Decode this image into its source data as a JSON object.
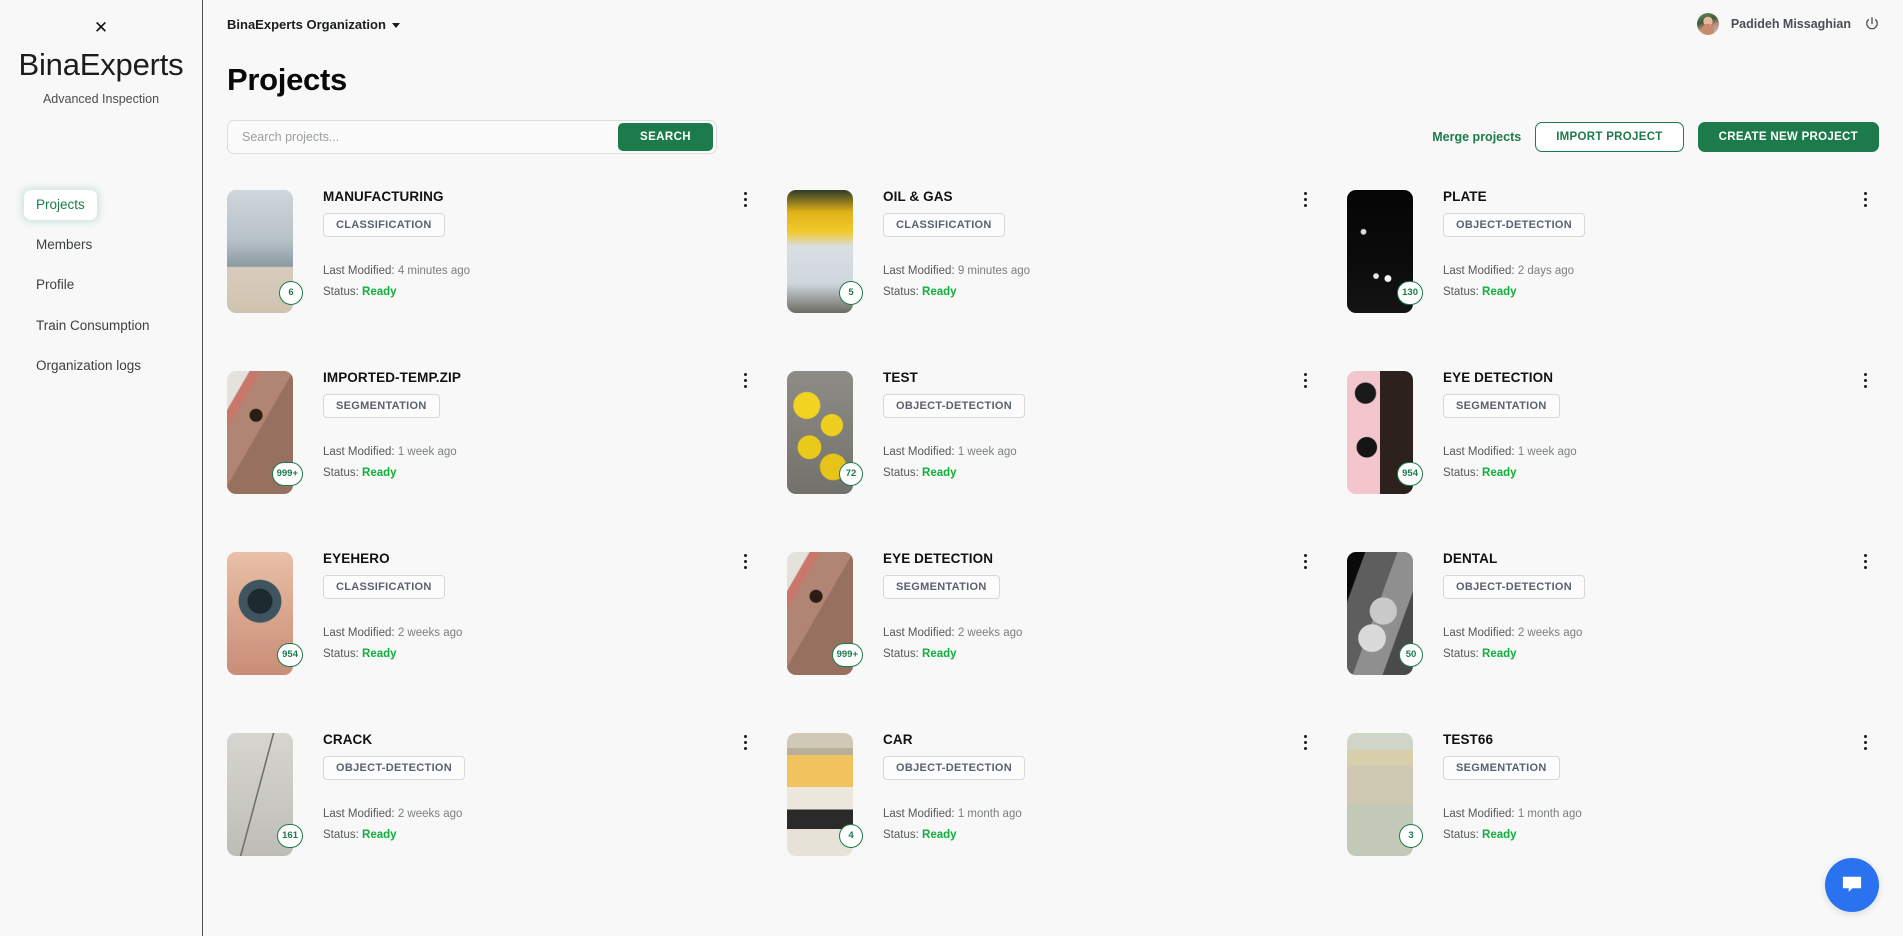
{
  "sidebar": {
    "close_icon": "close-icon",
    "brand": "BinaExperts",
    "tagline": "Advanced Inspection",
    "items": [
      {
        "label": "Projects",
        "active": true
      },
      {
        "label": "Members",
        "active": false
      },
      {
        "label": "Profile",
        "active": false
      },
      {
        "label": "Train Consumption",
        "active": false
      },
      {
        "label": "Organization logs",
        "active": false
      }
    ]
  },
  "topbar": {
    "organization": "BinaExperts Organization",
    "user_name": "Padideh Missaghian",
    "power_icon": "power-icon",
    "avatar_icon": "avatar"
  },
  "page": {
    "title": "Projects"
  },
  "search": {
    "placeholder": "Search projects...",
    "value": "",
    "button_label": "SEARCH"
  },
  "actions": {
    "merge_label": "Merge projects",
    "import_label": "IMPORT PROJECT",
    "create_label": "CREATE NEW PROJECT"
  },
  "labels": {
    "last_modified": "Last Modified:",
    "status": "Status:"
  },
  "colors": {
    "brand_green": "#1d7b4b",
    "status_green": "#0fb03c",
    "chat_blue": "#2a72f0",
    "page_bg": "#f7f8f7"
  },
  "chat": {
    "icon": "chat-bubble-icon"
  },
  "projects": [
    {
      "name": "MANUFACTURING",
      "type": "CLASSIFICATION",
      "modified": "4 minutes ago",
      "status": "Ready",
      "count": "6",
      "thumb": "manufacturing-robot-conveyor"
    },
    {
      "name": "OIL & GAS",
      "type": "CLASSIFICATION",
      "modified": "9 minutes ago",
      "status": "Ready",
      "count": "5",
      "thumb": "engineer-excavator"
    },
    {
      "name": "PLATE",
      "type": "OBJECT-DETECTION",
      "modified": "2 days ago",
      "status": "Ready",
      "count": "130",
      "thumb": "night-traffic-plate"
    },
    {
      "name": "IMPORTED-TEMP.ZIP",
      "type": "SEGMENTATION",
      "modified": "1 week ago",
      "status": "Ready",
      "count": "999+",
      "thumb": "face-eye-closeup"
    },
    {
      "name": "TEST",
      "type": "OBJECT-DETECTION",
      "modified": "1 week ago",
      "status": "Ready",
      "count": "72",
      "thumb": "yellow-objects-tray"
    },
    {
      "name": "EYE DETECTION",
      "type": "SEGMENTATION",
      "modified": "1 week ago",
      "status": "Ready",
      "count": "954",
      "thumb": "eye-collage-pink"
    },
    {
      "name": "EYEHERO",
      "type": "CLASSIFICATION",
      "modified": "2 weeks ago",
      "status": "Ready",
      "count": "954",
      "thumb": "human-eye-closeup"
    },
    {
      "name": "EYE DETECTION",
      "type": "SEGMENTATION",
      "modified": "2 weeks ago",
      "status": "Ready",
      "count": "999+",
      "thumb": "face-eye-closeup"
    },
    {
      "name": "DENTAL",
      "type": "OBJECT-DETECTION",
      "modified": "2 weeks ago",
      "status": "Ready",
      "count": "50",
      "thumb": "dental-xray-scan"
    },
    {
      "name": "CRACK",
      "type": "OBJECT-DETECTION",
      "modified": "2 weeks ago",
      "status": "Ready",
      "count": "161",
      "thumb": "concrete-crack"
    },
    {
      "name": "CAR",
      "type": "OBJECT-DETECTION",
      "modified": "1 month ago",
      "status": "Ready",
      "count": "4",
      "thumb": "kitchen-stove"
    },
    {
      "name": "TEST66",
      "type": "SEGMENTATION",
      "modified": "1 month ago",
      "status": "Ready",
      "count": "3",
      "thumb": "toothbrush-glass"
    }
  ]
}
